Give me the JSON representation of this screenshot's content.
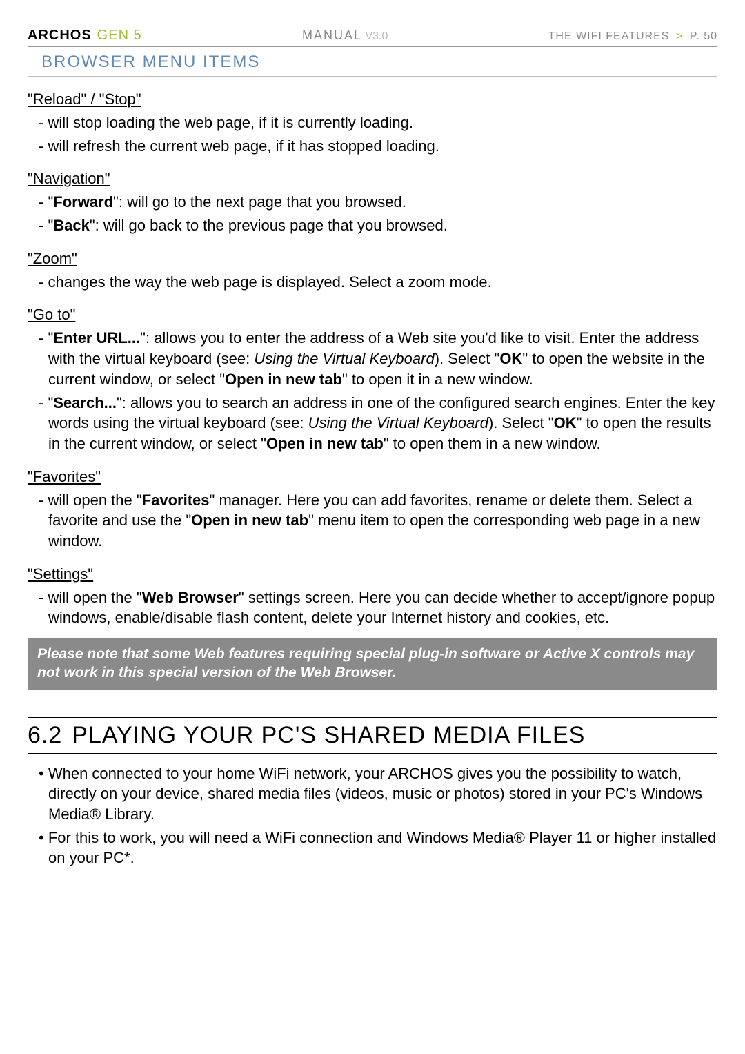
{
  "header": {
    "brand": "ARCHOS",
    "gen": "GEN 5",
    "manual_label": "MANUAL",
    "manual_version": "V3.0",
    "chapter": "THE WIFI FEATURES",
    "page": "P. 50"
  },
  "section_title": "BROWSER MENU ITEMS",
  "items": {
    "reload": {
      "heading": "\"Reload\" / \"Stop\"",
      "b1": "will stop loading the web page, if it is currently loading.",
      "b2": "will refresh the current web page, if it has stopped loading."
    },
    "navigation": {
      "heading": "\"Navigation\"",
      "forward_label": "Forward",
      "forward_text": ": will go to the next page that you browsed.",
      "back_label": "Back",
      "back_text": ": will go back to the previous page that you browsed."
    },
    "zoom": {
      "heading": "\"Zoom\"",
      "b1": "changes the way the web page is displayed. Select a zoom mode."
    },
    "goto": {
      "heading": "\"Go to\"",
      "enter_label": "Enter URL...",
      "enter_pre": ": allows you to enter the address of a Web site you'd like to visit. Enter the address with the virtual keyboard (see: ",
      "enter_ref": "Using the Virtual Keyboard",
      "enter_mid": "). Select \"",
      "ok": "OK",
      "enter_post1": "\" to open the website in the current window, or select \"",
      "open_new": "Open in new tab",
      "enter_post2": "\" to open it in a new window.",
      "search_label": "Search...",
      "search_pre": ": allows you to search an address in one of the configured search engines. Enter the key words using the virtual keyboard (see: ",
      "search_ref": "Using the Virtual Keyboard",
      "search_mid": "). Select \"",
      "search_post1": "\" to open the results in the current window, or select \"",
      "search_post2": "\" to open them in a new window."
    },
    "favorites": {
      "heading": "\"Favorites\"",
      "pre": "will open the \"",
      "label": "Favorites",
      "mid": "\" manager. Here you can add favorites, rename or delete them. Select a favorite and use the \"",
      "open_new": "Open in new tab",
      "post": "\" menu item to open the corresponding web page in a new window."
    },
    "settings": {
      "heading": "\"Settings\"",
      "pre": "will open the \"",
      "label": "Web Browser",
      "post": "\" settings screen. Here you can decide whether to accept/ignore popup windows, enable/disable flash content, delete your Internet history and cookies, etc."
    }
  },
  "note": "Please note that some Web features requiring special plug-in software or Active X controls may not work in this special version of the Web Browser.",
  "major": {
    "num": "6.2",
    "title": "PLAYING YOUR PC'S SHARED MEDIA FILES",
    "b1": "When connected to your home WiFi network, your ARCHOS gives you the possibility to watch, directly on your device, shared media files (videos, music or photos) stored in your PC's Windows Media® Library.",
    "b2": "For this to work, you will need a WiFi connection and Windows Media® Player 11 or higher installed on your PC*."
  }
}
